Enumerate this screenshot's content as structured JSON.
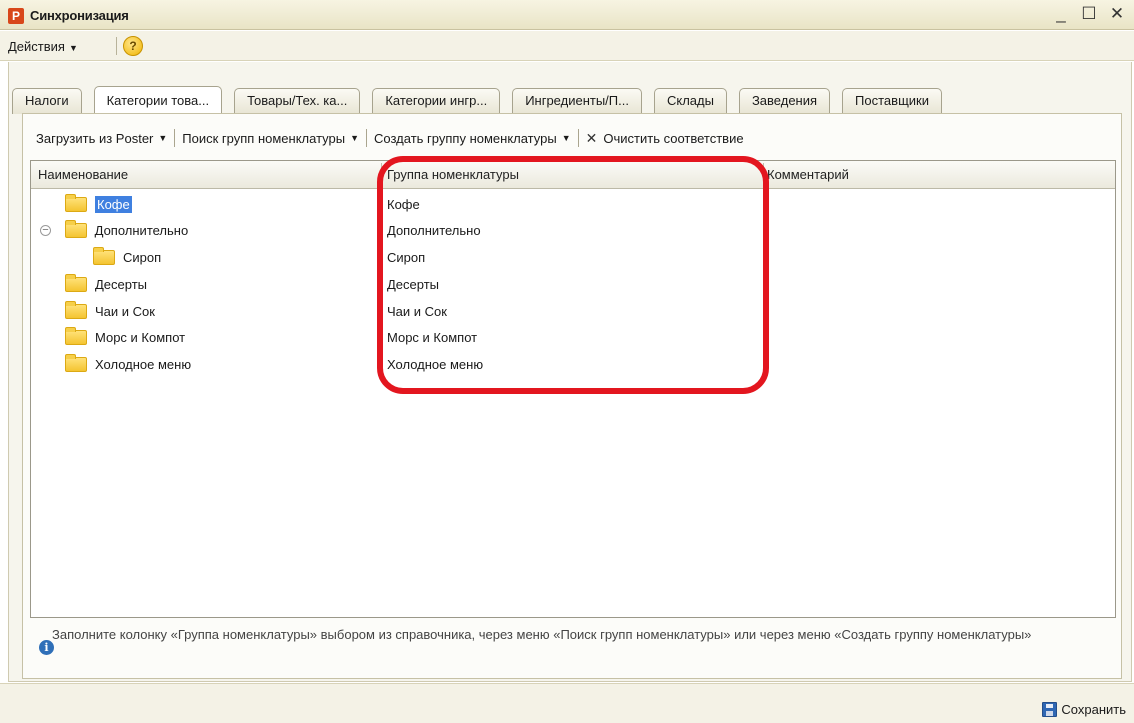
{
  "window": {
    "title": "Синхронизация",
    "logo_letter": "P",
    "controls": [
      "_",
      "☐",
      "✕"
    ]
  },
  "actionbar": {
    "actions_label": "Действия",
    "help_label": "?"
  },
  "tabs": [
    {
      "label": "Налоги",
      "active": false
    },
    {
      "label": "Категории това...",
      "active": true
    },
    {
      "label": "Товары/Тех. ка...",
      "active": false
    },
    {
      "label": "Категории ингр...",
      "active": false
    },
    {
      "label": "Ингредиенты/П...",
      "active": false
    },
    {
      "label": "Склады",
      "active": false
    },
    {
      "label": "Заведения",
      "active": false
    },
    {
      "label": "Поставщики",
      "active": false
    }
  ],
  "toolbar": {
    "load_label": "Загрузить из Poster",
    "search_groups_label": "Поиск групп номенклатуры",
    "create_group_label": "Создать группу номенклатуры",
    "clear_label": "Очистить соответствие"
  },
  "grid": {
    "columns": [
      "Наименование",
      "Группа номенклатуры",
      "Комментарий"
    ],
    "rows": [
      {
        "name": "Кофе",
        "group": "Кофе",
        "comment": "",
        "level": 0,
        "expander": false,
        "selected": true
      },
      {
        "name": "Дополнительно",
        "group": "Дополнительно",
        "comment": "",
        "level": 0,
        "expander": true,
        "selected": false
      },
      {
        "name": "Сироп",
        "group": "Сироп",
        "comment": "",
        "level": 1,
        "expander": false,
        "selected": false
      },
      {
        "name": "Десерты",
        "group": "Десерты",
        "comment": "",
        "level": 0,
        "expander": false,
        "selected": false
      },
      {
        "name": "Чаи и Сок",
        "group": "Чаи и Сок",
        "comment": "",
        "level": 0,
        "expander": false,
        "selected": false
      },
      {
        "name": "Морс и Компот",
        "group": "Морс и Компот",
        "comment": "",
        "level": 0,
        "expander": false,
        "selected": false
      },
      {
        "name": "Холодное меню",
        "group": "Холодное меню",
        "comment": "",
        "level": 0,
        "expander": false,
        "selected": false
      }
    ]
  },
  "hint": {
    "text": "Заполните колонку «Группа номенклатуры» выбором из справочника, через меню «Поиск групп номенклатуры» или через меню «Создать группу номенклатуры»"
  },
  "footer": {
    "save_label": "Сохранить"
  },
  "colors": {
    "highlight": "#e3161f",
    "selection": "#3f80e0",
    "folder": "#f4c431"
  }
}
